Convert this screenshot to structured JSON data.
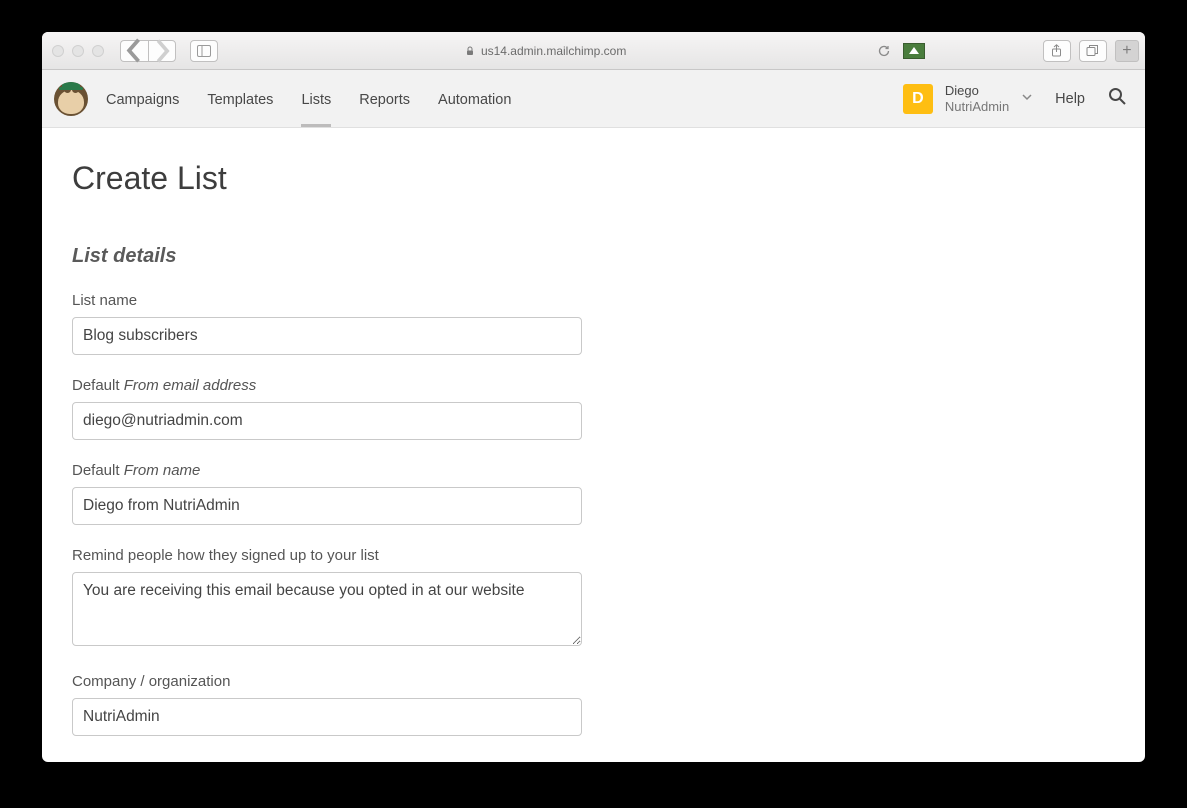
{
  "browser": {
    "url_display": "us14.admin.mailchimp.com"
  },
  "nav": {
    "campaigns": "Campaigns",
    "templates": "Templates",
    "lists": "Lists",
    "reports": "Reports",
    "automation": "Automation"
  },
  "account": {
    "initial": "D",
    "name": "Diego",
    "org": "NutriAdmin"
  },
  "header": {
    "help": "Help"
  },
  "page": {
    "title": "Create List",
    "section_title": "List details"
  },
  "fields": {
    "list_name": {
      "label": "List name",
      "value": "Blog subscribers"
    },
    "from_email": {
      "label_prefix": "Default ",
      "label_italic": "From email address",
      "value": "diego@nutriadmin.com"
    },
    "from_name": {
      "label_prefix": "Default ",
      "label_italic": "From name",
      "value": "Diego from NutriAdmin"
    },
    "reminder": {
      "label": "Remind people how they signed up to your list",
      "value": "You are receiving this email because you opted in at our website"
    },
    "company": {
      "label": "Company / organization",
      "value": "NutriAdmin"
    }
  }
}
